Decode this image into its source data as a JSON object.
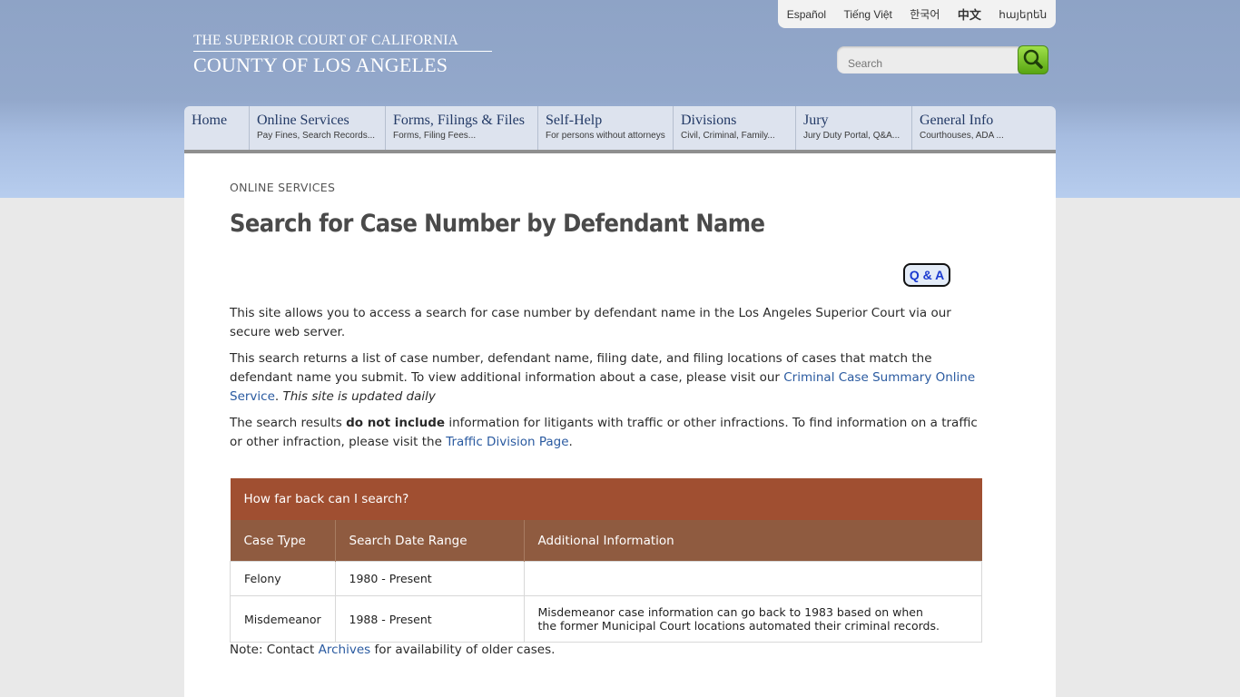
{
  "languages": [
    "Español",
    "Tiếng Việt",
    "한국어",
    "中文",
    "հայերեն"
  ],
  "logo": {
    "line1": "THE SUPERIOR COURT OF CALIFORNIA",
    "line2": "COUNTY OF LOS ANGELES"
  },
  "search": {
    "placeholder": "Search"
  },
  "nav": [
    {
      "title": "Home",
      "subtitle": ""
    },
    {
      "title": "Online Services",
      "subtitle": "Pay Fines, Search Records..."
    },
    {
      "title": "Forms, Filings & Files",
      "subtitle": "Forms, Filing Fees..."
    },
    {
      "title": "Self-Help",
      "subtitle": "For persons without attorneys"
    },
    {
      "title": "Divisions",
      "subtitle": "Civil, Criminal, Family..."
    },
    {
      "title": "Jury",
      "subtitle": "Jury Duty Portal, Q&A..."
    },
    {
      "title": "General Info",
      "subtitle": "Courthouses, ADA ..."
    }
  ],
  "breadcrumb": "ONLINE SERVICES",
  "page_title": "Search for Case Number by Defendant Name",
  "qa_label": "Q & A",
  "paragraph1": "This site allows you to access a search for case number by defendant name in the Los Angeles Superior Court via our secure web server.",
  "paragraph2": {
    "before": "This search returns a list of case number, defendant name, filing date, and filing locations of cases that match the defendant name you submit.  To view additional information about a case, please visit our ",
    "link": "Criminal Case Summary Online Service",
    "after": ".  ",
    "italic": "This site is updated daily"
  },
  "paragraph3": {
    "before": "The search results ",
    "bold": "do not include",
    "middle": " information for litigants with traffic or other infractions. To find information on a traffic or other infraction, please visit the ",
    "link": "Traffic Division Page",
    "after": "."
  },
  "table": {
    "caption": "How far back can I search?",
    "headers": [
      "Case Type",
      "Search Date Range",
      "Additional Information"
    ],
    "rows": [
      [
        "Felony",
        "1980 - Present",
        ""
      ],
      [
        "Misdemeanor",
        "1988 - Present",
        "Misdemeanor case information can go back to 1983 based on when the former Municipal Court locations automated their criminal records."
      ]
    ]
  },
  "note": {
    "before": "Note: Contact ",
    "link": "Archives",
    "after": " for availability of older cases."
  }
}
